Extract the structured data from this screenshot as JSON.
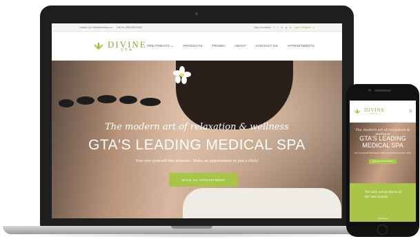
{
  "site": {
    "topbar": {
      "email": "Contact Us: info@divinespa.ca",
      "phone": "Call Us: (905) 883-0000",
      "stay_connected": "Stay connected:",
      "social_icons": [
        "twitter-icon",
        "facebook-icon",
        "instagram-icon",
        "google-plus-icon",
        "pinterest-icon"
      ],
      "account": "Login | Register",
      "cart_icon": "cart-icon"
    },
    "logo": {
      "name": "DIVINE",
      "sub": "SPA"
    },
    "nav": [
      {
        "label": "TREATMENTS ⌄"
      },
      {
        "label": "PRODUCTS"
      },
      {
        "label": "PROMO"
      },
      {
        "label": "ABOUT"
      },
      {
        "label": "CONTACT US"
      },
      {
        "label": "APPOINTMENTS"
      }
    ],
    "hero": {
      "script": "The modern art of relaxation & wellness",
      "title": "GTA'S LEADING MEDICAL SPA",
      "subtitle": "You owe yourself this moment. Make an appointment in just a click!",
      "cta": "MAKE AN APPOINTMENT"
    }
  },
  "phone": {
    "logo": {
      "name": "DIVINE",
      "sub": "SPA"
    },
    "menu_icon": "≡",
    "hero": {
      "script": "The modern art of relaxation & wellness",
      "title_line1": "GTA'S LEADING",
      "title_line2": "MEDICAL SPA",
      "subtitle": "You owe yourself this moment. Make an appointment in just a click!",
      "cta": "MAKE AN APPOINTMENT"
    },
    "green_section": {
      "line1": "We only use products of",
      "line2": "the best brands.",
      "footer": "divinespa.ca"
    }
  },
  "colors": {
    "accent_green": "#a9c449",
    "logo_green": "#8fa63a",
    "device_dark": "#1e1e1f"
  }
}
